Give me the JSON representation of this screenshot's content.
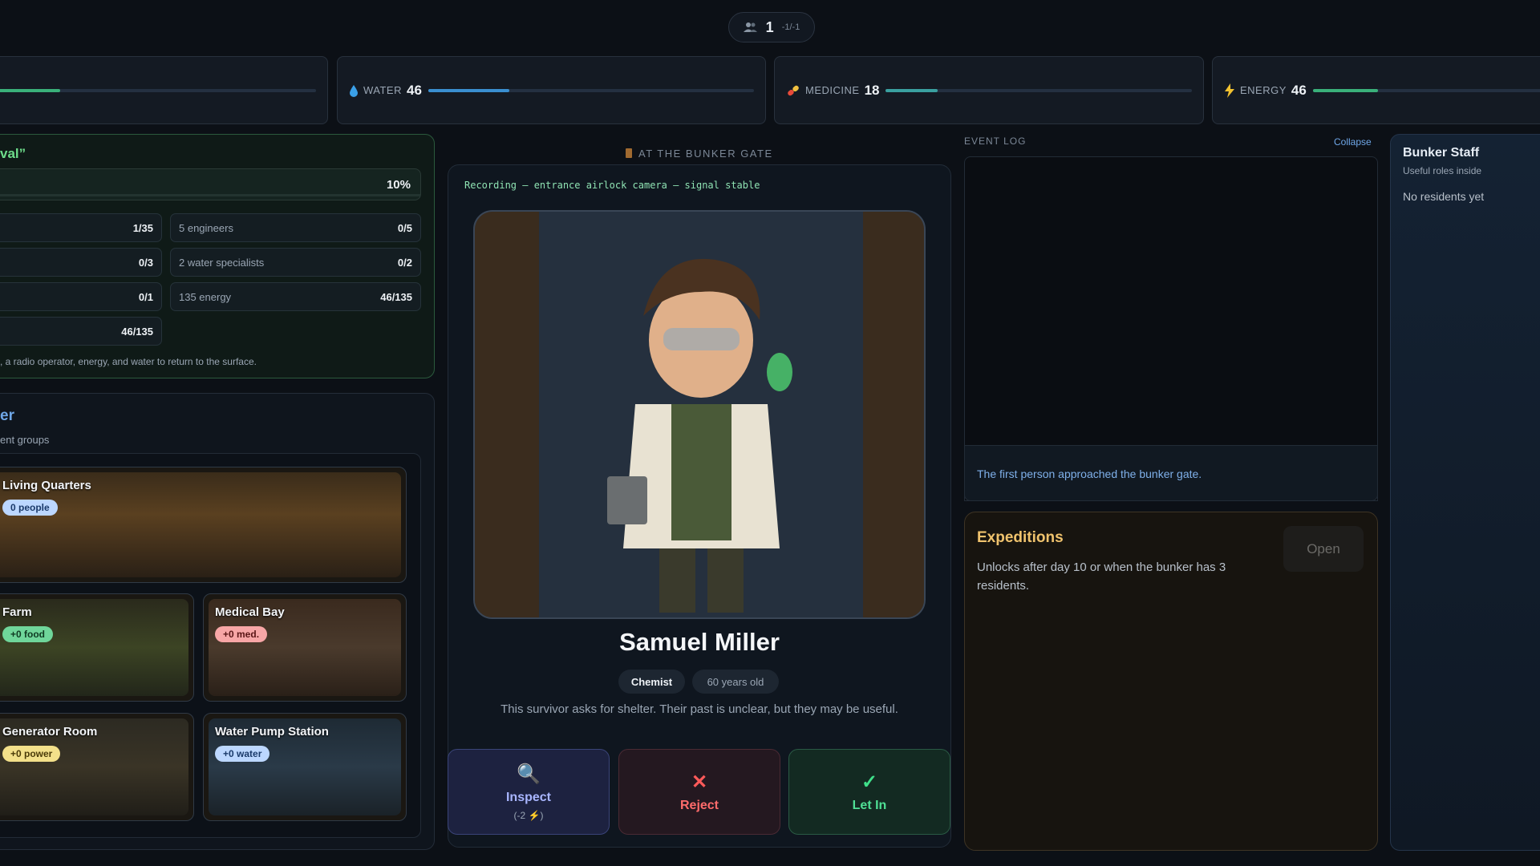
{
  "population": {
    "count": "1",
    "sub": "-1/-1",
    "icon": "people-icon"
  },
  "resources": [
    {
      "label": "WATER",
      "value": "46",
      "icon": "water-drop-icon",
      "color": "#3a8fd0"
    },
    {
      "label": "MEDICINE",
      "value": "18",
      "icon": "pill-icon",
      "color": "#3aa0a0"
    },
    {
      "label": "ENERGY",
      "value": "46",
      "icon": "lightning-icon",
      "color": "#3ab07a"
    }
  ],
  "goal": {
    "title": "val”",
    "progress": "10%",
    "rows": [
      {
        "label": "",
        "value": "1/35"
      },
      {
        "label": "5 engineers",
        "value": "0/5"
      },
      {
        "label": "",
        "value": "0/3"
      },
      {
        "label": "2 water specialists",
        "value": "0/2"
      },
      {
        "label": "",
        "value": "0/1"
      },
      {
        "label": "135 energy",
        "value": "46/135"
      },
      {
        "label": "",
        "value": "46/135"
      }
    ],
    "note": ", a radio operator, energy, and water to return to the surface."
  },
  "rooms": {
    "title": "er",
    "subtitle": "ent groups",
    "items": [
      {
        "name": "Living Quarters",
        "badge": "0 people",
        "badge_color": "#bcd7ff",
        "badge_text": "#1a3a6a"
      },
      {
        "name": "Farm",
        "badge": "+0 food",
        "badge_color": "#6fd69a",
        "badge_text": "#0f3a22"
      },
      {
        "name": "Medical Bay",
        "badge": "+0 med.",
        "badge_color": "#f7a6a6",
        "badge_text": "#5a1515"
      },
      {
        "name": "Generator Room",
        "badge": "+0 power",
        "badge_color": "#f3e08a",
        "badge_text": "#4a3a08"
      },
      {
        "name": "Water Pump Station",
        "badge": "+0 water",
        "badge_color": "#bcd7ff",
        "badge_text": "#1a3a6a"
      }
    ]
  },
  "gate": {
    "header": "AT THE BUNKER GATE",
    "recording": "Recording — entrance airlock camera — signal stable",
    "name": "Samuel Miller",
    "profession": "Chemist",
    "age": "60 years old",
    "description": "This survivor asks for shelter. Their past is unclear, but they may be useful.",
    "actions": {
      "inspect": {
        "label": "Inspect",
        "cost": "(-2 ⚡)",
        "icon": "magnifier-icon"
      },
      "reject": {
        "label": "Reject",
        "icon": "cross-icon"
      },
      "let_in": {
        "label": "Let In",
        "icon": "check-icon"
      }
    }
  },
  "event_log": {
    "label": "EVENT LOG",
    "collapse": "Collapse",
    "entries": [
      "The first person approached the bunker gate."
    ]
  },
  "expeditions": {
    "title": "Expeditions",
    "description": "Unlocks after day 10 or when the bunker has 3 residents.",
    "open_label": "Open"
  },
  "staff": {
    "title": "Bunker Staff",
    "subtitle": "Useful roles inside",
    "empty": "No residents yet"
  }
}
